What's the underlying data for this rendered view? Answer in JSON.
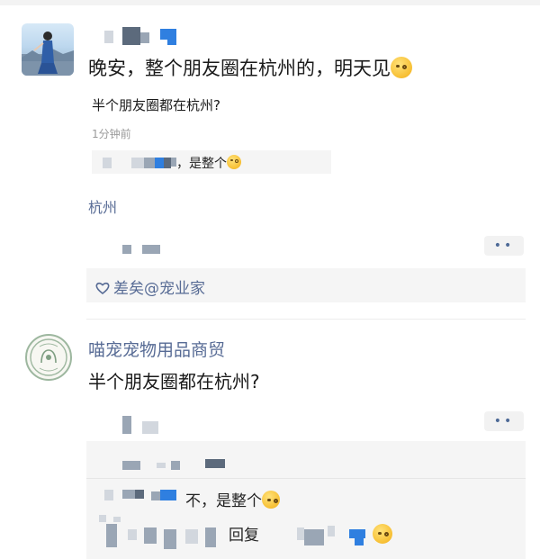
{
  "post1": {
    "text": "晚安，整个朋友圈在杭州的，明天见",
    "emoji_icon": "smirk-emoji-icon",
    "quote": {
      "title": "半个朋友圈都在杭州?",
      "time": "1分钟前",
      "reply_suffix": "，是整个"
    },
    "location": "杭州",
    "more_button": "••",
    "likes": "差矣@宠业家"
  },
  "post2": {
    "author": "喵宠宠物用品商贸",
    "text": "半个朋友圈都在杭州?",
    "more_button": "••",
    "replies": [
      {
        "text": "不，是整个"
      },
      {
        "text": "回复"
      }
    ]
  },
  "colors": {
    "link": "#576b95",
    "panel": "#f5f5f5",
    "text": "#1a1a1a",
    "meta": "#9a9a9a"
  }
}
